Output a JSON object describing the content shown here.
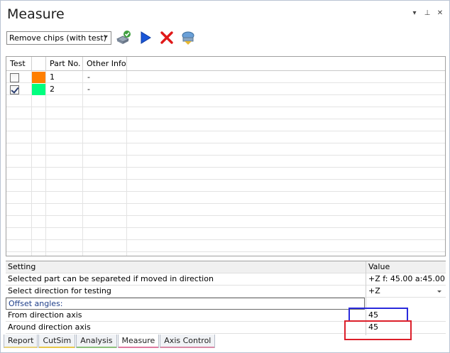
{
  "panel": {
    "title": "Measure",
    "controls": {
      "dropdown": "▾",
      "pin": "⊥",
      "close": "✕"
    }
  },
  "toolbar": {
    "mode_select": "Remove chips (with test)",
    "buttons": [
      {
        "name": "test-check-icon"
      },
      {
        "name": "play-icon"
      },
      {
        "name": "delete-x-icon"
      },
      {
        "name": "machine-part-icon"
      }
    ]
  },
  "grid": {
    "columns": [
      "Test",
      "",
      "Part No.",
      "Other Info"
    ],
    "rows": [
      {
        "checked": false,
        "color": "#ff7f00",
        "part_no": "1",
        "other": "-"
      },
      {
        "checked": true,
        "color": "#00ff7f",
        "part_no": "2",
        "other": "-"
      }
    ]
  },
  "properties": {
    "header": {
      "setting": "Setting",
      "value": "Value"
    },
    "rows": [
      {
        "name": "Selected part can be separeted if moved in direction",
        "value": "+Z f: 45.00 a:45.00"
      },
      {
        "name": "Select direction for testing",
        "value": "+Z"
      }
    ],
    "category": "Offset angles:",
    "offset_rows": [
      {
        "name": "From direction axis",
        "value": "45"
      },
      {
        "name": "Around direction axis",
        "value": "45"
      }
    ]
  },
  "tabs": [
    {
      "label": "Report",
      "color": "#e8d27a"
    },
    {
      "label": "CutSim",
      "color": "#e8c84a"
    },
    {
      "label": "Analysis",
      "color": "#8cc07a"
    },
    {
      "label": "Measure",
      "color": "#e07aa0",
      "active": true
    },
    {
      "label": "Axis Control",
      "color": "#d98aa8"
    }
  ],
  "colors": {
    "highlight_blue": "#2a2adc",
    "highlight_red": "#dc1f2a"
  }
}
